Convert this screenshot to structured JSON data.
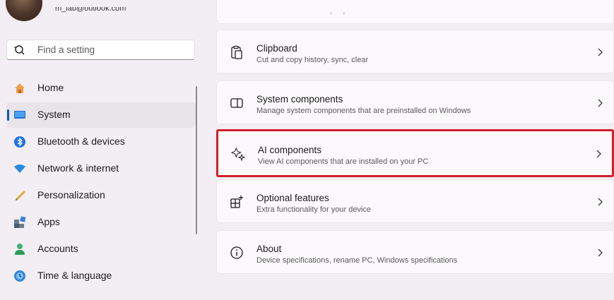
{
  "account": {
    "email": "m_lab@outlook.com"
  },
  "search": {
    "placeholder": "Find a setting"
  },
  "nav": {
    "items": [
      {
        "label": "Home",
        "icon": "home-icon"
      },
      {
        "label": "System",
        "icon": "system-icon",
        "selected": true
      },
      {
        "label": "Bluetooth & devices",
        "icon": "bluetooth-icon"
      },
      {
        "label": "Network & internet",
        "icon": "network-icon"
      },
      {
        "label": "Personalization",
        "icon": "personalization-icon"
      },
      {
        "label": "Apps",
        "icon": "apps-icon"
      },
      {
        "label": "Accounts",
        "icon": "accounts-icon"
      },
      {
        "label": "Time & language",
        "icon": "time-language-icon"
      }
    ]
  },
  "top_fragment": ", ,",
  "cards": [
    {
      "title": "Clipboard",
      "desc": "Cut and copy history, sync, clear",
      "icon": "clipboard-icon"
    },
    {
      "title": "System components",
      "desc": "Manage system components that are preinstalled on Windows",
      "icon": "system-components-icon"
    },
    {
      "title": "AI components",
      "desc": "View AI components that are installed on your PC",
      "icon": "ai-sparkle-icon",
      "highlighted": true
    },
    {
      "title": "Optional features",
      "desc": "Extra functionality for your device",
      "icon": "optional-features-icon"
    },
    {
      "title": "About",
      "desc": "Device specifications, rename PC, Windows specifications",
      "icon": "info-icon"
    }
  ],
  "colors": {
    "accent": "#005fb8",
    "highlight": "#d21f2c",
    "background": "#f3eef4"
  }
}
